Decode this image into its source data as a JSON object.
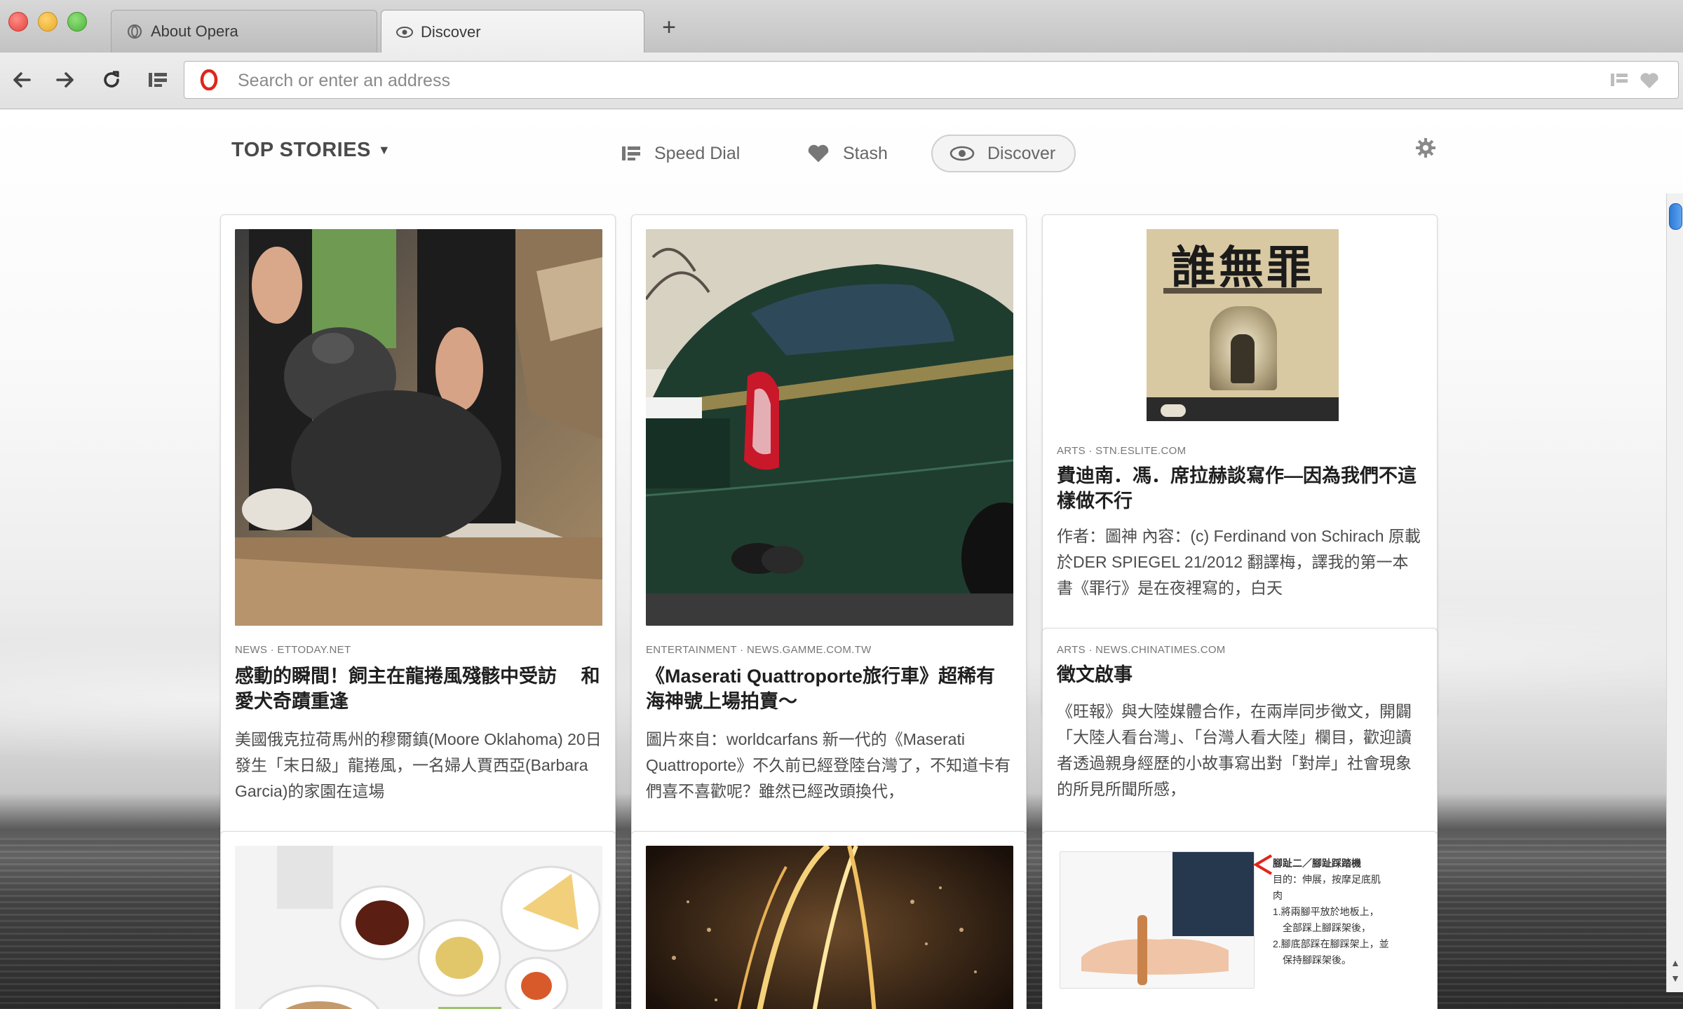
{
  "browser": {
    "tabs": [
      {
        "label": "About Opera",
        "icon": "opera-icon",
        "active": false
      },
      {
        "label": "Discover",
        "icon": "eye-icon",
        "active": true
      }
    ],
    "new_tab_label": "+"
  },
  "toolbar": {
    "address_placeholder": "Search or enter an address",
    "address_value": ""
  },
  "discover": {
    "section_title": "TOP STORIES",
    "nav": {
      "speed_dial": "Speed Dial",
      "stash": "Stash",
      "discover": "Discover"
    }
  },
  "cards": [
    {
      "source": "NEWS · ETTODAY.NET",
      "title": "感動的瞬間！飼主在龍捲風殘骸中受訪 　和愛犬奇蹟重逢",
      "excerpt": "美國俄克拉荷馬州的穆爾鎮(Moore Oklahoma) 20日發生「末日級」龍捲風，一名婦人賈西亞(Barbara Garcia)的家園在這場"
    },
    {
      "source": "ENTERTAINMENT · NEWS.GAMME.COM.TW",
      "title": "《Maserati Quattroporte旅行車》超稀有海神號上場拍賣～",
      "excerpt": "圖片來自：worldcarfans 新一代的《Maserati Quattroporte》不久前已經登陸台灣了，不知道卡有們喜不喜歡呢？雖然已經改頭換代，"
    },
    {
      "source": "ARTS · STN.ESLITE.COM",
      "title": "費迪南．馮．席拉赫談寫作—因為我們不這樣做不行",
      "excerpt": "作者：圖神 內容：(c) Ferdinand von Schirach 原載於DER SPIEGEL 21/2012 翻譯梅，譯我的第一本書《罪行》是在夜裡寫的，白天",
      "book_cover_text": "誰無罪"
    },
    {
      "source": "ARTS · NEWS.CHINATIMES.COM",
      "title": "徵文啟事",
      "excerpt": "《旺報》與大陸媒體合作，在兩岸同步徵文，開闢「大陸人看台灣」、「台灣人看大陸」欄目，歡迎讀者透過親身經歷的小故事寫出對「對岸」社會現象的所見所聞所感，"
    },
    {
      "source": "",
      "title": "",
      "excerpt": ""
    },
    {
      "source": "",
      "title": "",
      "excerpt": ""
    },
    {
      "source": "",
      "title": "",
      "excerpt": "",
      "inset_lines": [
        "腳趾二／腳趾踩踏機",
        "目的：伸展，按摩足底肌",
        "肉",
        "1.將兩腳平放於地板上，",
        "　全部踩上腳踩架後，",
        "2.腳底部踩在腳踩架上，並",
        "　保持腳踩架後。"
      ]
    }
  ],
  "colors": {
    "accent_blue": "#2d7ad6",
    "opera_red": "#e0251b",
    "tail_light_red": "#c8182a",
    "car_green": "#1f3d2f"
  }
}
